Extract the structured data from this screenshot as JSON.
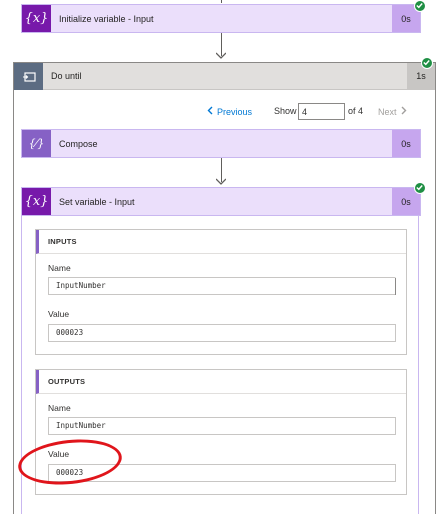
{
  "actions": {
    "initialize": {
      "title": "Initialize variable - Input",
      "duration": "0s",
      "icon": "variable-icon",
      "color": "#7719aa"
    },
    "compose": {
      "title": "Compose",
      "duration": "0s",
      "icon": "compose-icon",
      "color": "#8661c5"
    },
    "set_variable": {
      "title": "Set variable - Input",
      "duration": "0s",
      "icon": "variable-icon",
      "color": "#7719aa"
    }
  },
  "do_until": {
    "title": "Do until",
    "duration": "1s",
    "icon": "loop-icon"
  },
  "pager": {
    "previous_label": "Previous",
    "show_label": "Show",
    "current_page": "4",
    "of_label": "of 4",
    "next_label": "Next"
  },
  "inputs": {
    "header": "INPUTS",
    "name_label": "Name",
    "name_value": "InputNumber",
    "value_label": "Value",
    "value_value": "000023"
  },
  "outputs": {
    "header": "OUTPUTS",
    "name_label": "Name",
    "name_value": "InputNumber",
    "value_label": "Value",
    "value_value": "000023"
  },
  "colors": {
    "success": "#1f8f44",
    "annotation": "#e0151b",
    "link": "#0078d4"
  }
}
